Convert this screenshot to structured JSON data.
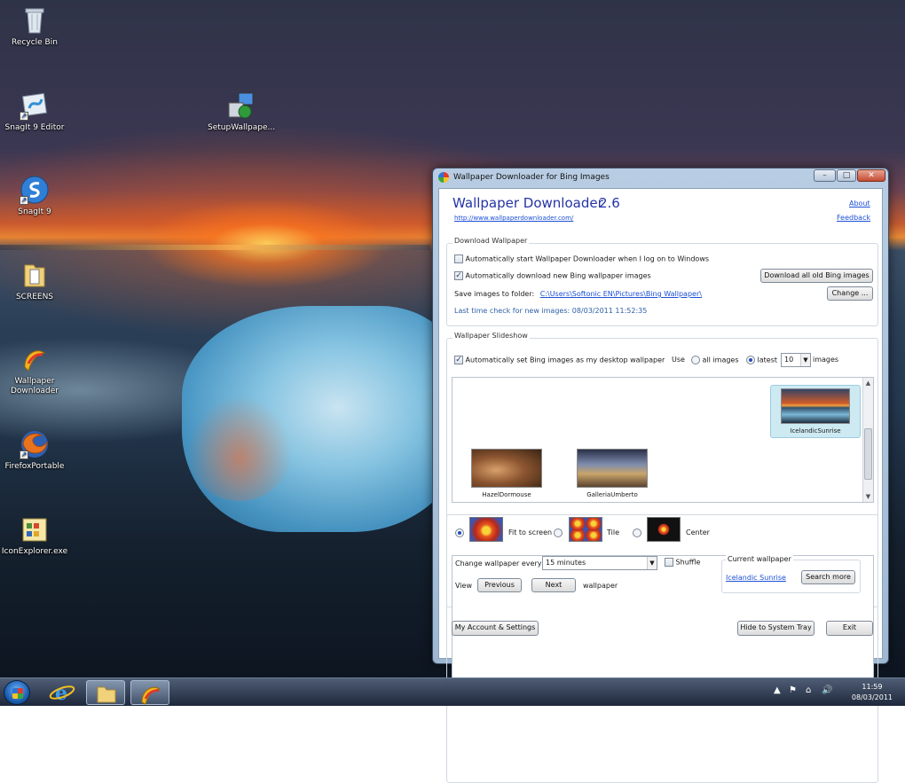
{
  "desktop_icons": [
    {
      "label": "Recycle Bin"
    },
    {
      "label": "SnagIt 9 Editor"
    },
    {
      "label": "SetupWallpape..."
    },
    {
      "label": "SnagIt 9"
    },
    {
      "label": "SCREENS"
    },
    {
      "label": "Wallpaper Downloader"
    },
    {
      "label": "FirefoxPortable"
    },
    {
      "label": "IconExplorer.exe"
    }
  ],
  "window": {
    "title": "Wallpaper Downloader for Bing Images",
    "controls": {
      "minimize": "–",
      "maximize": "□",
      "close": "✕"
    }
  },
  "header": {
    "app_name": "Wallpaper Downloader",
    "version": "2.6",
    "url": "http://www.wallpaperdownloader.com/",
    "about": "About",
    "feedback": "Feedback"
  },
  "download": {
    "group_title": "Download Wallpaper",
    "auto_start": {
      "label": "Automatically start Wallpaper Downloader when I log on to Windows",
      "checked": false
    },
    "auto_download": {
      "label": "Automatically download new Bing wallpaper images",
      "checked": true
    },
    "download_all_button": "Download all old Bing images",
    "save_label": "Save images to folder:",
    "save_path": "C:\\Users\\Softonic EN\\Pictures\\Bing Wallpaper\\",
    "change_button": "Change ...",
    "last_check": "Last time check for new images: 08/03/2011 11:52:35"
  },
  "slideshow": {
    "group_title": "Wallpaper Slideshow",
    "auto_set": {
      "label": "Automatically set Bing images as my desktop wallpaper",
      "checked": true
    },
    "use_label": "Use",
    "all_images": "all images",
    "latest": "latest",
    "latest_count": "10",
    "images": "images",
    "thumbnails": [
      {
        "name": "IcelandicSunrise",
        "selected": true
      },
      {
        "name": "HazelDormouse",
        "selected": false
      },
      {
        "name": "GalleriaUmberto",
        "selected": false
      }
    ],
    "modes": [
      {
        "label": "Fit to screen",
        "selected": true
      },
      {
        "label": "Tile",
        "selected": false
      },
      {
        "label": "Center",
        "selected": false
      }
    ],
    "change_every_label": "Change wallpaper every",
    "change_every_value": "15 minutes",
    "shuffle": {
      "label": "Shuffle",
      "checked": false
    },
    "view_label": "View",
    "previous_button": "Previous",
    "next_button": "Next",
    "wallpaper_label": "wallpaper",
    "current_wallpaper_title": "Current wallpaper",
    "current_wallpaper_link": "Icelandic Sunrise",
    "search_more_button": "Search more"
  },
  "footer": {
    "account_button": "My Account & Settings",
    "hide_button": "Hide to System Tray",
    "exit_button": "Exit"
  },
  "taskbar": {
    "time": "11:59",
    "date": "08/03/2011",
    "tray_icons": [
      "▲",
      "⚑",
      "⌂",
      "🔊"
    ]
  }
}
